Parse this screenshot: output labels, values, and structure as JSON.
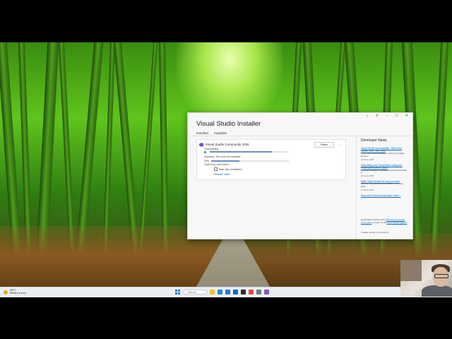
{
  "installer": {
    "title": "Visual Studio Installer",
    "tabs": [
      {
        "label": "Installed",
        "active": true
      },
      {
        "label": "Available",
        "active": false
      }
    ],
    "product": {
      "name": "Visual Studio Community 2026",
      "pause_label": "Pause",
      "more_label": "···",
      "downloading_label": "Downloading",
      "download_progress_pct": 80,
      "installing_label": "Installing - file count not available",
      "install_percent_text": "36%",
      "install_progress_pct": 36,
      "sub_status": "Optimizing assemblies...",
      "start_after_label": "Start after installation",
      "release_notes_label": "Release notes"
    },
    "news": {
      "title": "Developer News",
      "items": [
        {
          "headline": "Visual Studio now Available - Build Your Dream, Your Own Tools",
          "desc": "The 1 last version available in Cumul of usage version...",
          "date": "23 June 2025"
        },
        {
          "headline": "Generating your Visual Basic using your model with GitHub Copilot",
          "desc": "If you're building or troubleshooting Visual Studio a...",
          "date": "20 June 2025"
        },
        {
          "headline": "Make Visual Studio the way you want",
          "desc": "Now our pre-personal, focus after for modern lead...",
          "date": "11 June 2025"
        }
      ],
      "more_label": "View more Microsoft developer news..."
    },
    "help": {
      "prefix": "Need help? Check out the ",
      "link1": "Microsoft Developer Community",
      "middle": " or reach us via ",
      "link2": "Visual Studio Support",
      "suffix": "."
    },
    "version": "Installer version 3.14.2116.16"
  },
  "window_controls": {
    "icon1": "☼",
    "icon2": "⚲",
    "minimize": "–",
    "maximize": "☐",
    "close": "✕"
  },
  "taskbar": {
    "weather_temp": "28°C",
    "weather_desc": "Mostly sunny",
    "search_placeholder": "Search",
    "apps": [
      "file-explorer-icon",
      "edge-icon",
      "store-icon",
      "mail-icon",
      "terminal-icon",
      "chrome-icon",
      "settings-icon",
      "visual-studio-icon"
    ],
    "app_colors": [
      "#f0c330",
      "#1c8ad8",
      "#3a6fd8",
      "#0f6cbd",
      "#2d2d2d",
      "#e0463a",
      "#707b86",
      "#8a55c8"
    ]
  }
}
